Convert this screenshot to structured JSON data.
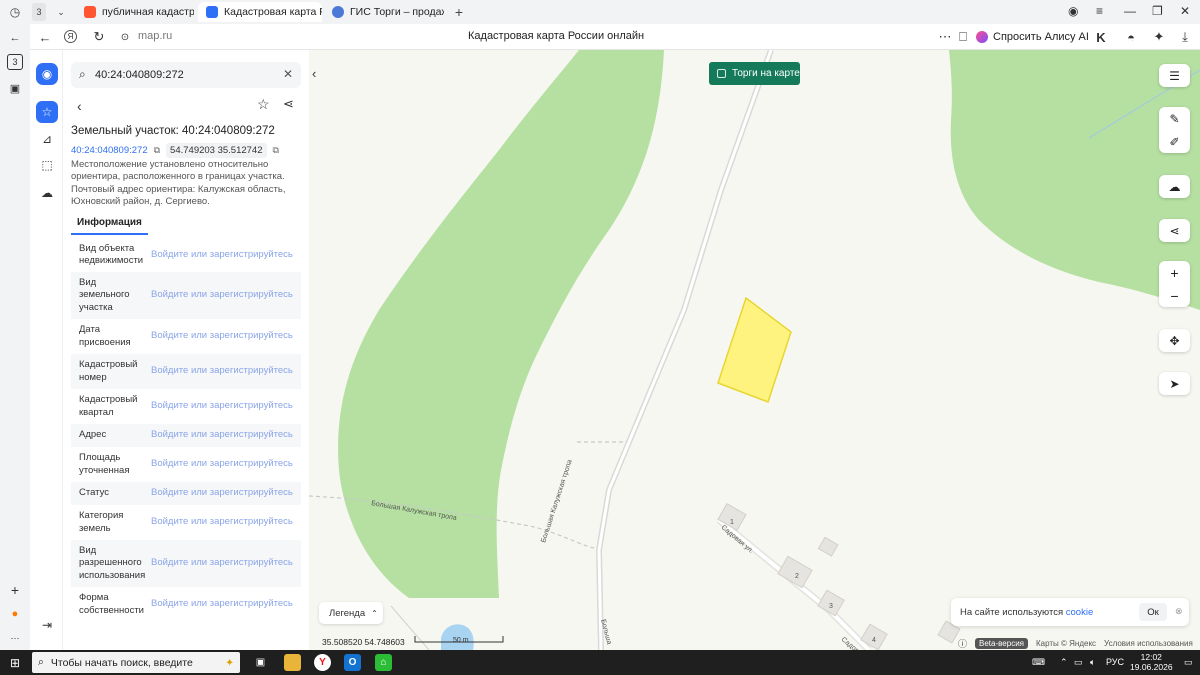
{
  "browser": {
    "tab_count": "3",
    "tabs": [
      {
        "label": "публичная кадастровая к",
        "active": false
      },
      {
        "label": "Кадастровая карта Рос",
        "active": true
      },
      {
        "label": "ГИС Торги – продажи гос",
        "active": false
      }
    ],
    "new_tab": "+",
    "url": "map.ru",
    "page_title": "Кадастровая карта России онлайн",
    "alice_label": "Спросить Алису AI",
    "side_badge": "3"
  },
  "search": {
    "value": "40:24:040809:272"
  },
  "parcel": {
    "title": "Земельный участок: 40:24:040809:272",
    "cadastral_number": "40:24:040809:272",
    "coordinates": "54.749203 35.512742",
    "description": "Местоположение установлено относительно ориентира, расположенного в границах участка. Почтовый адрес ориентира: Калужская область, Юхновский район, д. Сергиево."
  },
  "info_tab": "Информация",
  "info_rows": [
    {
      "key": "Вид объекта недвижимости",
      "value": "Войдите или зарегистрируйтесь"
    },
    {
      "key": "Вид земельного участка",
      "value": "Войдите или зарегистрируйтесь"
    },
    {
      "key": "Дата присвоения",
      "value": "Войдите или зарегистрируйтесь"
    },
    {
      "key": "Кадастровый номер",
      "value": "Войдите или зарегистрируйтесь"
    },
    {
      "key": "Кадастровый квартал",
      "value": "Войдите или зарегистрируйтесь"
    },
    {
      "key": "Адрес",
      "value": "Войдите или зарегистрируйтесь"
    },
    {
      "key": "Площадь уточненная",
      "value": "Войдите или зарегистрируйтесь"
    },
    {
      "key": "Статус",
      "value": "Войдите или зарегистрируйтесь"
    },
    {
      "key": "Категория земель",
      "value": "Войдите или зарегистрируйтесь"
    },
    {
      "key": "Вид разрешенного использования",
      "value": "Войдите или зарегистрируйтесь"
    },
    {
      "key": "Форма собственности",
      "value": "Войдите или зарегистрируйтесь"
    }
  ],
  "map": {
    "torgi_label": "Торги на карте",
    "legend_label": "Легенда",
    "coord_readout": "35.508520  54.748603",
    "scale_label": "50 m",
    "road_labels": [
      "Большая Калужская тропа",
      "Большая Калужская тропа",
      "Садовая ул.",
      "Садов",
      "Больша"
    ],
    "house_numbers": [
      "1",
      "2",
      "3",
      "4"
    ],
    "cookie_text": "На сайте используются",
    "cookie_link": "cookie",
    "cookie_ok": "Ок",
    "beta": "Beta-версия",
    "attribution": "Карты © Яндекс",
    "terms": "Условия использования",
    "colors": {
      "forest": "#b5e0a1",
      "parcel": "#fff380",
      "parcel_stroke": "#e8d630",
      "background": "#f7f7f2",
      "accent": "#2f6ff5",
      "torgi": "#157a5a"
    }
  },
  "taskbar": {
    "search_placeholder": "Чтобы начать поиск, введите",
    "lang": "РУС",
    "time": "12:02",
    "date": "19.06.2026"
  }
}
